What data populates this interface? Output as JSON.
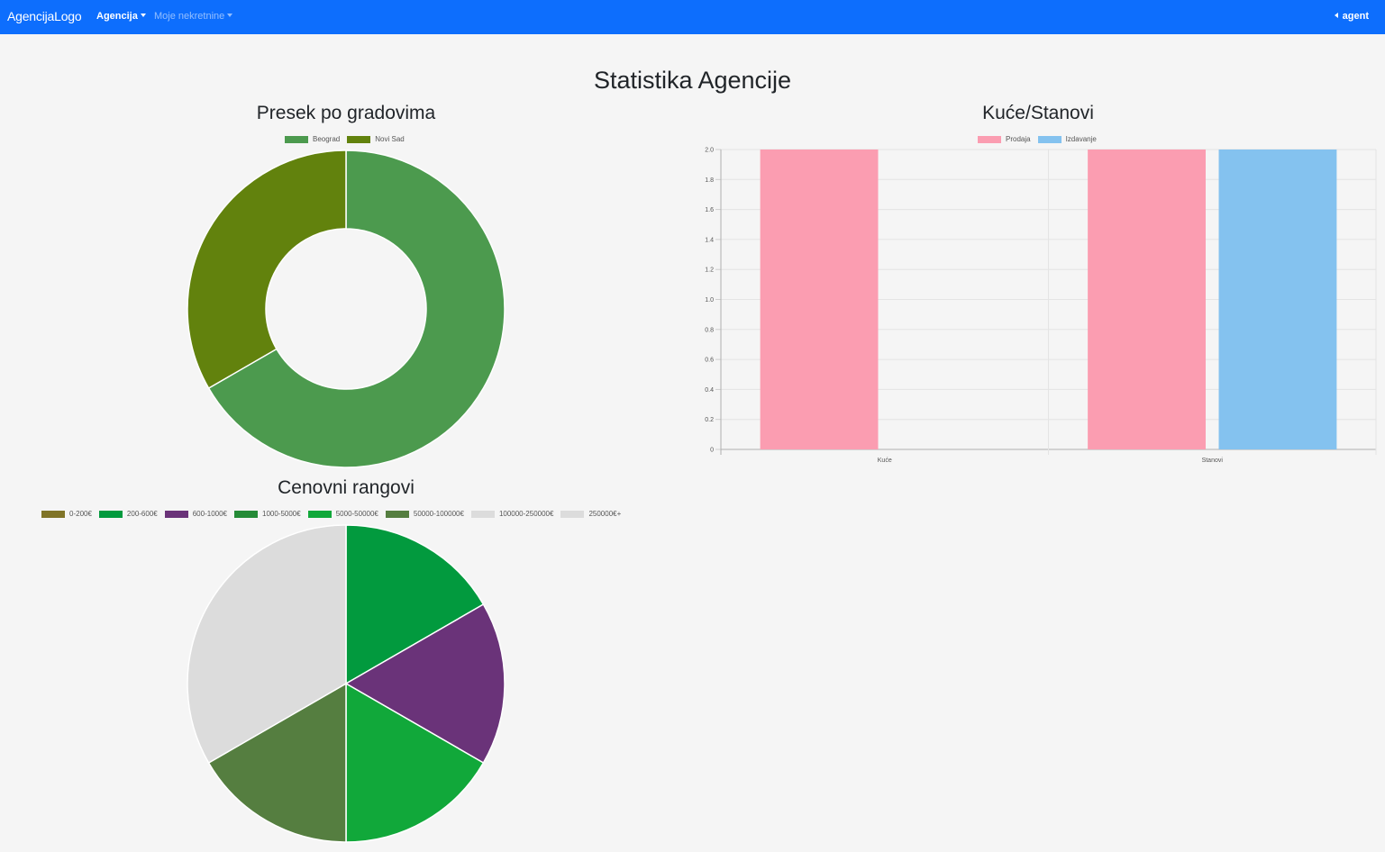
{
  "navbar": {
    "brand": "AgencijaLogo",
    "menu_agencija": "Agencija",
    "menu_moje": "Moje nekretnine",
    "user": "agent",
    "background": "#0d6efd"
  },
  "page_title": "Statistika Agencije",
  "chart_data": [
    {
      "type": "pie",
      "variant": "doughnut",
      "title": "Presek po gradovima",
      "legend_position": "top",
      "labels": [
        "Beograd",
        "Novi Sad"
      ],
      "values": [
        2,
        1
      ],
      "colors": [
        "#4c9a4e",
        "#62820d"
      ]
    },
    {
      "type": "bar",
      "title": "Kuće/Stanovi",
      "legend_position": "top",
      "grid": true,
      "categories": [
        "Kuće",
        "Stanovi"
      ],
      "series": [
        {
          "name": "Prodaja",
          "values": [
            2,
            2
          ],
          "color": "#fb9db1"
        },
        {
          "name": "Izdavanje",
          "values": [
            0,
            2
          ],
          "color": "#84c2ef"
        }
      ],
      "ylim": [
        0,
        2
      ],
      "yticks": [
        "2.0",
        "1.8",
        "1.6",
        "1.4",
        "1.2",
        "1.0",
        "0.8",
        "0.6",
        "0.4",
        "0.2",
        "0"
      ]
    },
    {
      "type": "pie",
      "title": "Cenovni rangovi",
      "legend_position": "top",
      "labels": [
        "0-200€",
        "200-600€",
        "600-1000€",
        "1000-5000€",
        "5000-50000€",
        "50000-100000€",
        "100000-250000€",
        "250000€+"
      ],
      "values": [
        0,
        1,
        1,
        0,
        1,
        1,
        0,
        2
      ],
      "colors": [
        "#807428",
        "#029a3e",
        "#6a3379",
        "#258b37",
        "#11a83a",
        "#557e40",
        "#dcdcdc",
        "#dcdcdc"
      ]
    }
  ]
}
